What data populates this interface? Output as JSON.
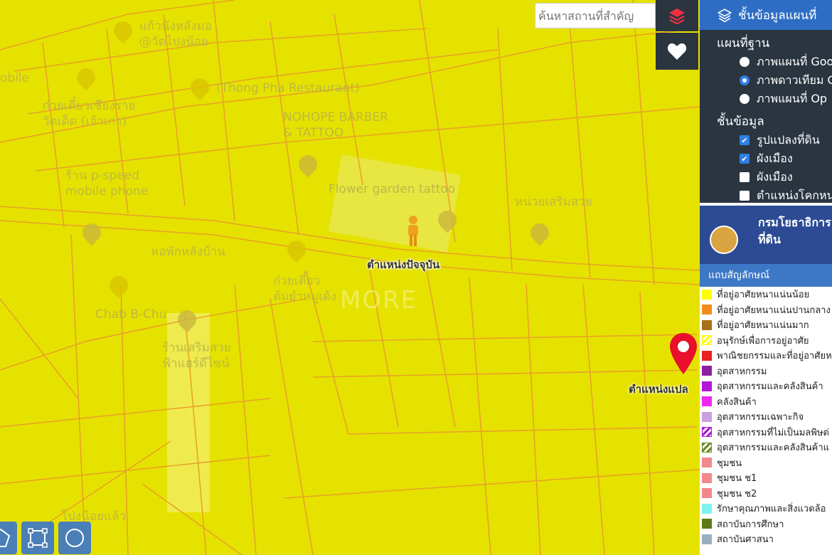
{
  "map": {
    "current_position_label": "ตำแหน่งปัจจุบัน",
    "target_label": "ตำแหน่งแปล",
    "watermark": "MORE",
    "labels": [
      {
        "name": "label-kaitong",
        "text": "แก้วนังหลังมอ\n@วัดไปงน้อย"
      },
      {
        "name": "label-mobile-left",
        "text": "obile"
      },
      {
        "name": "label-thong-pha",
        "text": "(Thong Pha Restaurant)"
      },
      {
        "name": "label-noodle-left",
        "text": "ก๋วยเตี๋ยวเชียงราย\nวัดเด็ด (เจ้าเก่า)"
      },
      {
        "name": "label-nohope",
        "text": "NOHOPE BARBER\n& TATTOO"
      },
      {
        "name": "label-speed",
        "text": "ร้าน p-speed\nmobile phone"
      },
      {
        "name": "label-flower",
        "text": "Flower garden tattoo"
      },
      {
        "name": "label-beauty",
        "text": "หน่วยเสริมสวย"
      },
      {
        "name": "label-dorm",
        "text": "หอพักหลังบ้าน"
      },
      {
        "name": "label-noodle-mid",
        "text": "ก๋วยเตี๋ยว\nต้มยำหมูเด้ง"
      },
      {
        "name": "label-chab",
        "text": "Chab B-Chu"
      },
      {
        "name": "label-salon",
        "text": "ร้านเสริมสวย\nฟ้าแฮร์ดีไซน์"
      },
      {
        "name": "label-bottom",
        "text": "โป่งน้อยแล้ว"
      }
    ]
  },
  "search": {
    "placeholder": "ค้นหาสถานที่สำคัญ"
  },
  "layer_panel": {
    "title": "ชั้นข้อมูลแผนที่",
    "base_section": "แผนที่ฐาน",
    "base_options": [
      {
        "label": "ภาพแผนที่ Goo",
        "selected": false
      },
      {
        "label": "ภาพดาวเทียม G",
        "selected": true
      },
      {
        "label": "ภาพแผนที่ Op",
        "selected": false
      }
    ],
    "data_section": "ชั้นข้อมูล",
    "data_options": [
      {
        "label": "รูปแปลงที่ดิน",
        "checked": true
      },
      {
        "label": "ผังเมือง",
        "checked": true
      },
      {
        "label": "ผังเมือง",
        "checked": false
      },
      {
        "label": "ตำแหน่งโคกหน",
        "checked": false
      }
    ]
  },
  "department": {
    "name": "กรมโยธาธิการ\nที่ดิน"
  },
  "legend": {
    "title": "แถบสัญลักษณ์",
    "items": [
      {
        "label": "ที่อยู่อาศัยหนาแน่นน้อย",
        "color": "#ffff00",
        "pattern": "solid"
      },
      {
        "label": "ที่อยู่อาศัยหนาแน่นปานกลาง",
        "color": "#f28c1c",
        "pattern": "solid"
      },
      {
        "label": "ที่อยู่อาศัยหนาแน่นมาก",
        "color": "#a9701c",
        "pattern": "solid"
      },
      {
        "label": "อนุรักษ์เพื่อการอยู่อาศัย",
        "color": "#ffff00",
        "pattern": "hatch"
      },
      {
        "label": "พาณิชยกรรมและที่อยู่อาศัยห",
        "color": "#e8201e",
        "pattern": "solid"
      },
      {
        "label": "อุตสาหกรรม",
        "color": "#8b1fa0",
        "pattern": "solid"
      },
      {
        "label": "อุตสาหกรรมและคลังสินค้า",
        "color": "#b018d8",
        "pattern": "solid"
      },
      {
        "label": "คลังสินค้า",
        "color": "#ee28ee",
        "pattern": "solid"
      },
      {
        "label": "อุตสาหกรรมเฉพาะกิจ",
        "color": "#c9a0e0",
        "pattern": "solid"
      },
      {
        "label": "อุตสาหกรรมที่ไม่เป็นมลพิษต่",
        "color": "#b018d8",
        "pattern": "hatch"
      },
      {
        "label": "อุตสาหกรรมและคลังสินค้าแ",
        "color": "#6b8a1c",
        "pattern": "hatch"
      },
      {
        "label": "ชุมชน",
        "color": "#f0888c",
        "pattern": "solid"
      },
      {
        "label": "ชุมชน  ช1",
        "color": "#f0888c",
        "pattern": "solid"
      },
      {
        "label": "ชุมชน  ช2",
        "color": "#f0888c",
        "pattern": "solid"
      },
      {
        "label": "รักษาคุณภาพและสิ่งแวดล้อ",
        "color": "#7ff2f2",
        "pattern": "solid"
      },
      {
        "label": "สถาบันการศึกษา",
        "color": "#5e7a16",
        "pattern": "solid"
      },
      {
        "label": "สถาบันศาสนา",
        "color": "#9ab0c0",
        "pattern": "solid"
      }
    ]
  },
  "icons": {
    "layers": "layers-icon",
    "heart": "heart-icon",
    "pin": "map-pin-icon",
    "pegman": "pegman-icon"
  }
}
